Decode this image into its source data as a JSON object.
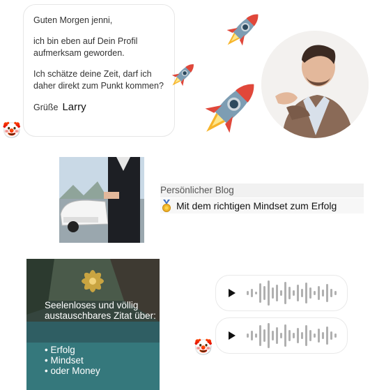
{
  "chat": {
    "greeting": "Guten Morgen jenni,",
    "line1": "ich bin eben auf Dein Profil aufmerksam geworden.",
    "line2": "Ich schätze deine Zeit, darf ich daher direkt zum Punkt kommen?",
    "closing": "Grüße",
    "signature": "Larry"
  },
  "blog": {
    "label": "Persönlicher Blog",
    "title": "Mit dem richtigen Mindset zum Erfolg",
    "medal_icon": "medal-icon"
  },
  "quote": {
    "text": "Seelenloses und völlig austauschbares Zitat über:",
    "items": [
      "• Erfolg",
      "• Mindset",
      "• oder Money"
    ]
  },
  "emojis": {
    "clown": "🤡",
    "rocket": "rocket-icon"
  },
  "colors": {
    "bubble_border": "#e6e6e6",
    "voice_wave": "#b0b0b0",
    "quote_bg": "#3a4a42"
  }
}
